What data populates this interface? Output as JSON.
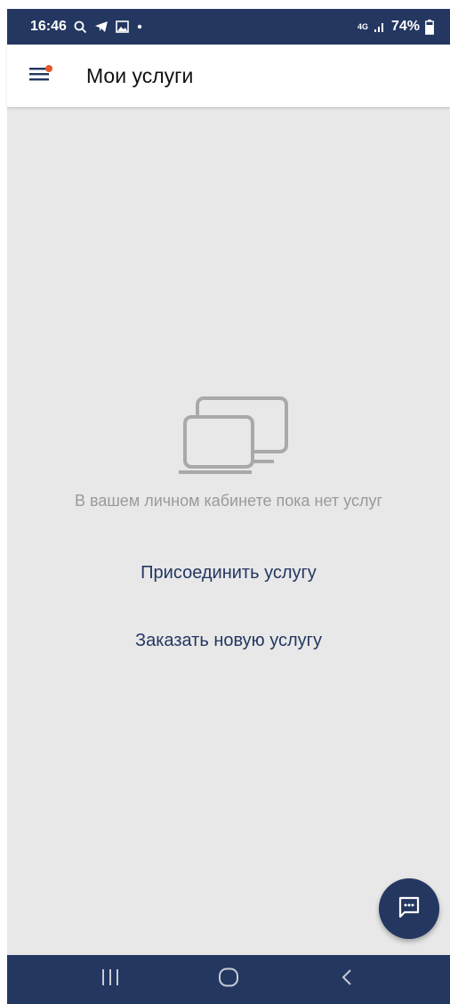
{
  "status_bar": {
    "time": "16:46",
    "network": "4G",
    "battery": "74%"
  },
  "app_bar": {
    "title": "Мои услуги",
    "menu_icon": "hamburger-menu-icon",
    "notification_dot_color": "#e8572a"
  },
  "empty_state": {
    "icon": "devices-icon",
    "message": "В вашем личном кабинете пока нет услуг"
  },
  "actions": {
    "attach_label": "Присоединить услугу",
    "order_label": "Заказать новую услугу"
  },
  "fab": {
    "icon": "chat-icon"
  },
  "nav_bar": {
    "recent_icon": "recent-apps-icon",
    "home_icon": "home-icon",
    "back_icon": "back-icon"
  },
  "colors": {
    "brand": "#233761",
    "background": "#e8e8e8",
    "muted_text": "#9a9a9a",
    "accent": "#e8572a"
  }
}
